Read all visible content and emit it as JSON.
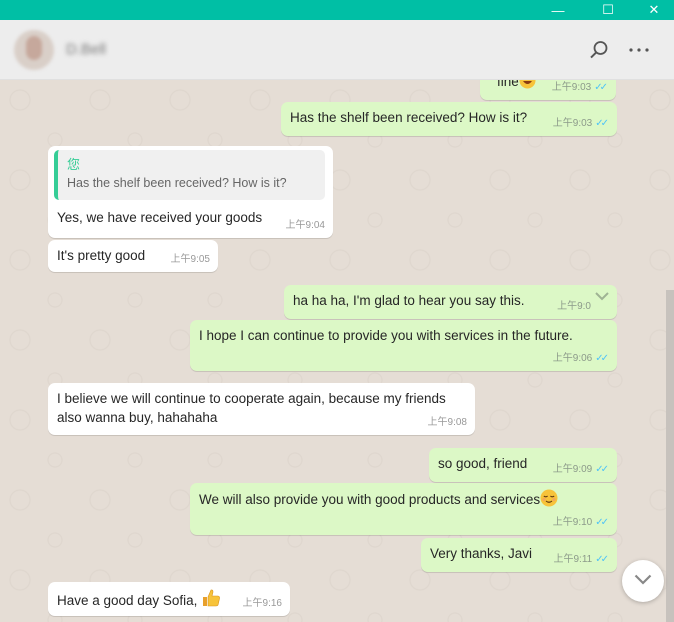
{
  "window": {
    "min_glyph": "—",
    "max_glyph": "☐",
    "close_glyph": "✕"
  },
  "header": {
    "contact_name": "D.Bell",
    "icons": [
      "search-icon",
      "menu-icon"
    ]
  },
  "messages": [
    {
      "dir": "out",
      "text": "fine",
      "time": "上午9:03"
    },
    {
      "dir": "out",
      "text": "Has the shelf been received? How is it?",
      "time": "上午9:03"
    },
    {
      "dir": "in",
      "quote_author": "您",
      "quote_text": "Has the shelf been received? How is it?",
      "text": "Yes, we have received your goods",
      "time": "上午9:04"
    },
    {
      "dir": "in",
      "text": "It's pretty good",
      "time": "上午9:05"
    },
    {
      "dir": "out",
      "text": "ha ha ha, I'm glad to hear you say this.",
      "time": "上午9:0"
    },
    {
      "dir": "out",
      "text": "I hope I can continue to provide you with services in the future.",
      "time": "上午9:06"
    },
    {
      "dir": "in",
      "text": "I believe we will continue to cooperate again, because my friends",
      "text2": "also wanna buy, hahahaha",
      "time": "上午9:08"
    },
    {
      "dir": "out",
      "text": "so good, friend",
      "time": "上午9:09"
    },
    {
      "dir": "out",
      "text": "We will also provide you with good products and services",
      "time": "上午9:10"
    },
    {
      "dir": "out",
      "text": "Very thanks, Javi",
      "time": "上午9:11"
    },
    {
      "dir": "in",
      "text": "Have a good day Sofia,",
      "time": "上午9:16"
    }
  ],
  "colors": {
    "titlebar": "#00bfa5",
    "outgoing_bubble": "#dcf8c6",
    "incoming_bubble": "#ffffff",
    "read_tick": "#4fc3f7",
    "quote_accent": "#35cd96"
  }
}
